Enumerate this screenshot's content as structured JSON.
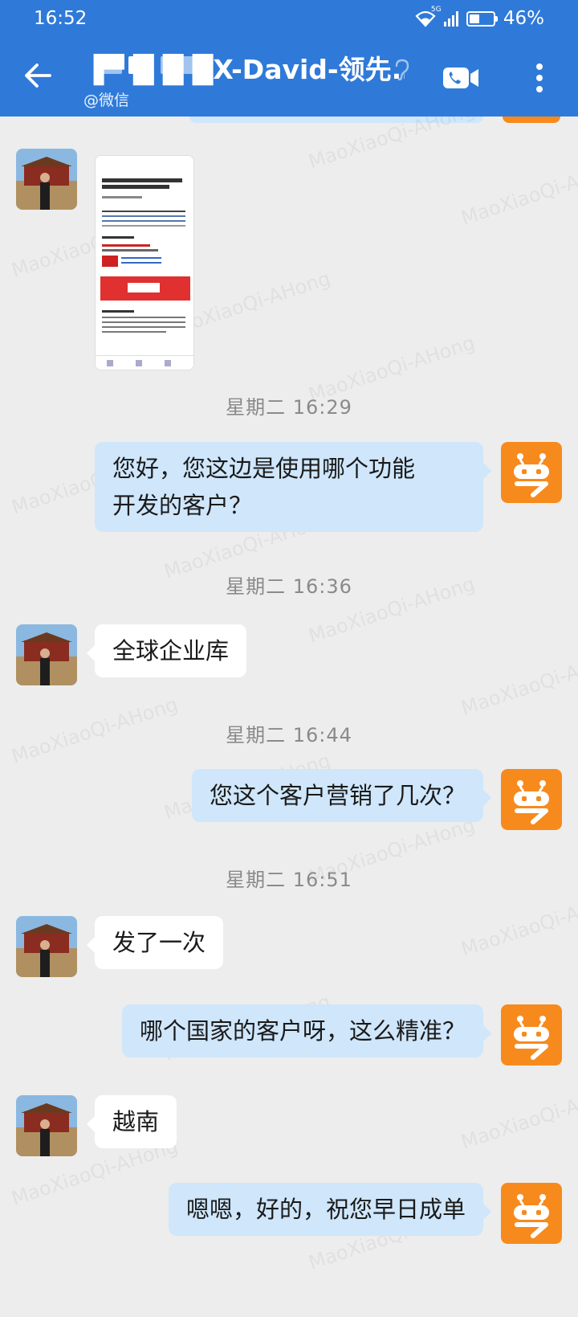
{
  "status_bar": {
    "time": "16:52",
    "network": "5G",
    "battery": "46%"
  },
  "header": {
    "title": "\\ ■ ■ ■ X-David-领先...",
    "title_visible": "▐▀ █ █ █X-David-领先...",
    "subtitle": "@微信"
  },
  "watermark_text": "MaoXiaoQi-AHong",
  "messages": [
    {
      "type": "time",
      "text": "星期二  16:29"
    },
    {
      "type": "self",
      "text_line1": "您好，您这边是使用哪个功能",
      "text_line2": "开发的客户？"
    },
    {
      "type": "time",
      "text": "星期二  16:36"
    },
    {
      "type": "peer",
      "text": "全球企业库"
    },
    {
      "type": "time",
      "text": "星期二  16:44"
    },
    {
      "type": "self",
      "text": "您这个客户营销了几次？"
    },
    {
      "type": "time",
      "text": "星期二  16:51"
    },
    {
      "type": "peer",
      "text": "发了一次"
    },
    {
      "type": "self",
      "text": "哪个国家的客户呀，这么精准？"
    },
    {
      "type": "peer",
      "text": "越南"
    },
    {
      "type": "self",
      "text": "嗯嗯，好的，祝您早日成单"
    }
  ],
  "image_message": {
    "heading": "RE: Re:RE: Wantlar Electronics terminal blocks and connectors",
    "section": "Best regards",
    "contact": "Field Application Engineering Staff",
    "body": "Dear Sir, Our company is a professional manufacturer of terminal blocks and connectors."
  },
  "colors": {
    "header": "#2f7ad9",
    "self_bubble": "#cfe6fb",
    "peer_bubble": "#ffffff",
    "bot_avatar": "#f78a1d",
    "background": "#ededed"
  }
}
